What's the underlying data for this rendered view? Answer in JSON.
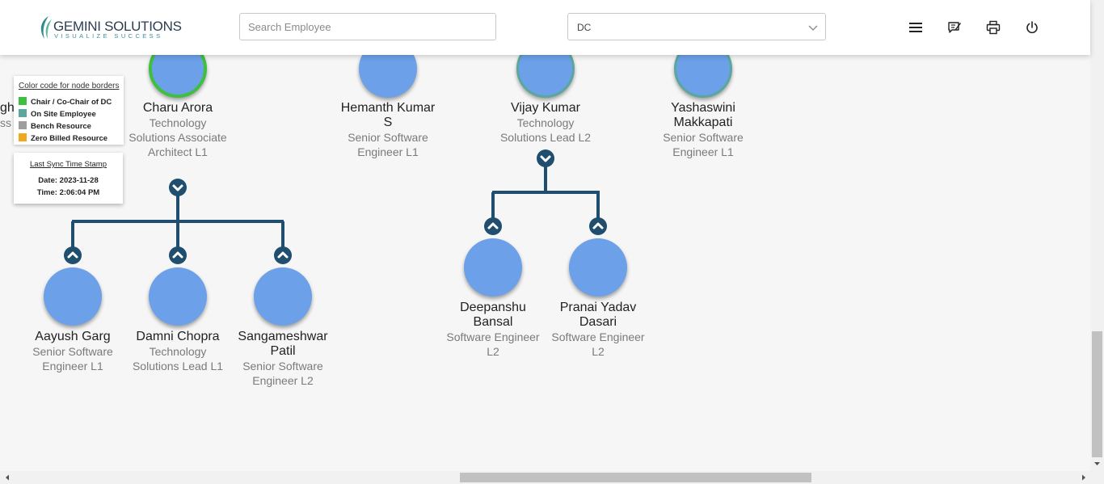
{
  "header": {
    "logo_name": "GEMINI SOLUTIONS",
    "logo_tagline": "VISUALIZE SUCCESS",
    "search_placeholder": "Search Employee",
    "dropdown_value": "DC",
    "icons": [
      "menu-icon",
      "feedback-icon",
      "print-icon",
      "power-icon"
    ]
  },
  "legend": {
    "title": "Color code for node borders",
    "items": [
      {
        "label": "Chair / Co-Chair of DC",
        "color": "#3fbf3f"
      },
      {
        "label": "On Site Employee",
        "color": "#5aa79f"
      },
      {
        "label": "Bench Resource",
        "color": "#9e9e9e"
      },
      {
        "label": "Zero Billed Resource",
        "color": "#f0a81c"
      }
    ]
  },
  "sync": {
    "title": "Last Sync Time Stamp",
    "date": "Date: 2023-11-28",
    "time": "Time: 2:06:04 PM"
  },
  "clipped": {
    "name_fragment": "gh",
    "role_fragment": "ss"
  },
  "top_nodes": [
    {
      "name": "Charu Arora",
      "role": "Technology Solutions Associate Architect L1"
    },
    {
      "name": "Hemanth Kumar S",
      "role": "Senior Software Engineer L1"
    },
    {
      "name": "Vijay Kumar",
      "role": "Technology Solutions Lead L2"
    },
    {
      "name": "Yashaswini Makkapati",
      "role": "Senior Software Engineer L1"
    }
  ],
  "charu_reports": [
    {
      "name": "Aayush Garg",
      "role": "Senior Software Engineer L1"
    },
    {
      "name": "Damni Chopra",
      "role": "Technology Solutions Lead L1"
    },
    {
      "name": "Sangameshwar Patil",
      "role": "Senior Software Engineer L2"
    }
  ],
  "vijay_reports": [
    {
      "name": "Deepanshu Bansal",
      "role": "Software Engineer L2"
    },
    {
      "name": "Pranai Yadav Dasari",
      "role": "Software Engineer L2"
    }
  ],
  "colors": {
    "node": "#6ca0e8",
    "connector": "#1f4e6e",
    "chair_border": "#3fbf3f",
    "onsite_border": "#5aa79f"
  }
}
